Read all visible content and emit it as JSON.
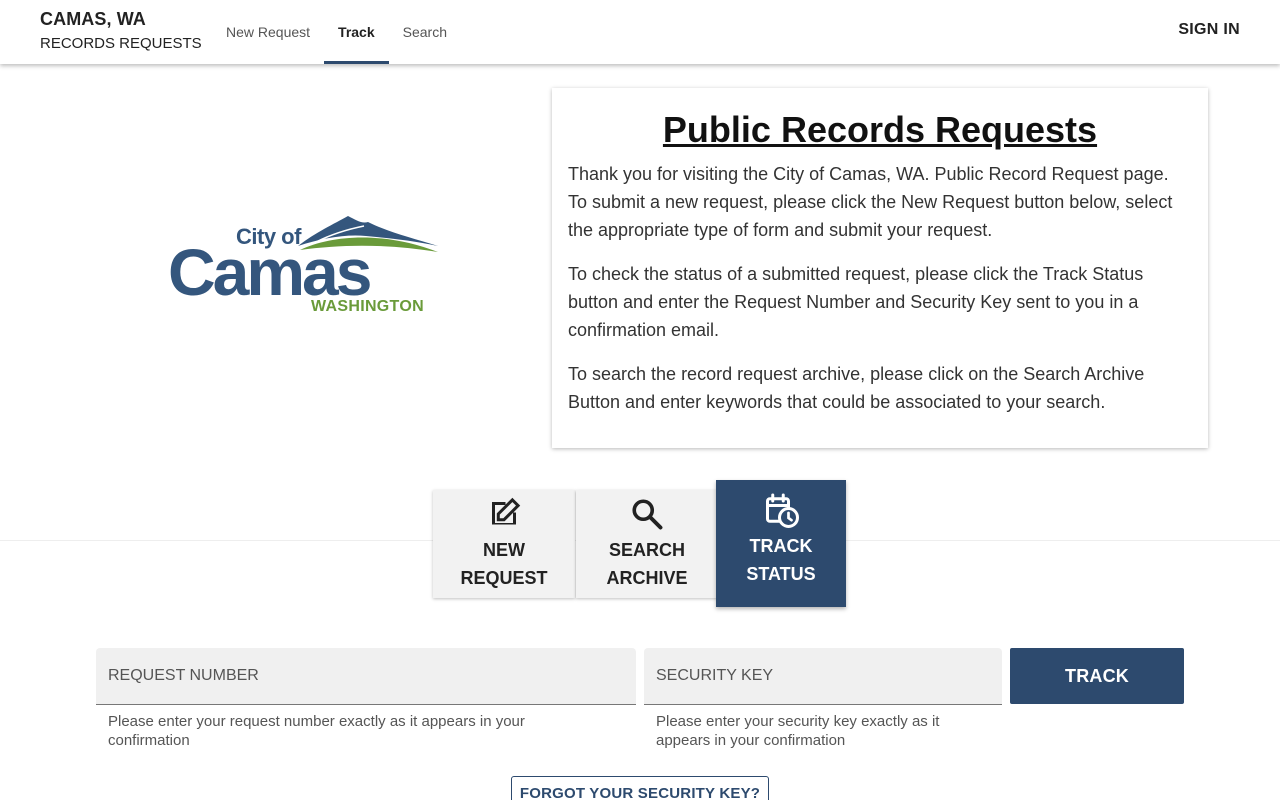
{
  "header": {
    "title": "CAMAS, WA",
    "subtitle": "RECORDS REQUESTS",
    "tabs": [
      {
        "label": "New Request",
        "active": false
      },
      {
        "label": "Track",
        "active": true
      },
      {
        "label": "Search",
        "active": false
      }
    ],
    "sign_in": "SIGN IN"
  },
  "logo": {
    "line1": "City of",
    "line2": "Camas",
    "line3": "WASHINGTON"
  },
  "intro": {
    "heading": "Public Records Requests",
    "paragraphs": [
      "Thank you for visiting the City of Camas, WA. Public Record Request page. To submit a new request, please click the New Request button below, select the appropriate type of form and submit your request.",
      "To check the status of a submitted request, please click the Track Status button and enter the Request Number and Security Key sent to you in a confirmation email.",
      "To search the record request archive, please click on the Search Archive Button and enter keywords that could be associated to your search."
    ]
  },
  "actions": {
    "new_request": {
      "line1": "NEW",
      "line2": "REQUEST",
      "icon": "edit-icon"
    },
    "search_archive": {
      "line1": "SEARCH",
      "line2": "ARCHIVE",
      "icon": "search-icon"
    },
    "track_status": {
      "line1": "TRACK",
      "line2": "STATUS",
      "icon": "calendar-clock-icon",
      "selected": true
    }
  },
  "form": {
    "request_number": {
      "placeholder": "REQUEST NUMBER",
      "value": "",
      "hint": "Please enter your request number exactly as it appears in your confirmation"
    },
    "security_key": {
      "placeholder": "SECURITY KEY",
      "value": "",
      "hint": "Please enter your security key exactly as it appears in your confirmation"
    },
    "track_label": "TRACK",
    "forgot_label": "FORGOT YOUR SECURITY KEY?"
  },
  "colors": {
    "primary": "#2d4a6e",
    "logo_blue": "#34567d",
    "logo_green": "#6a9b3a"
  }
}
